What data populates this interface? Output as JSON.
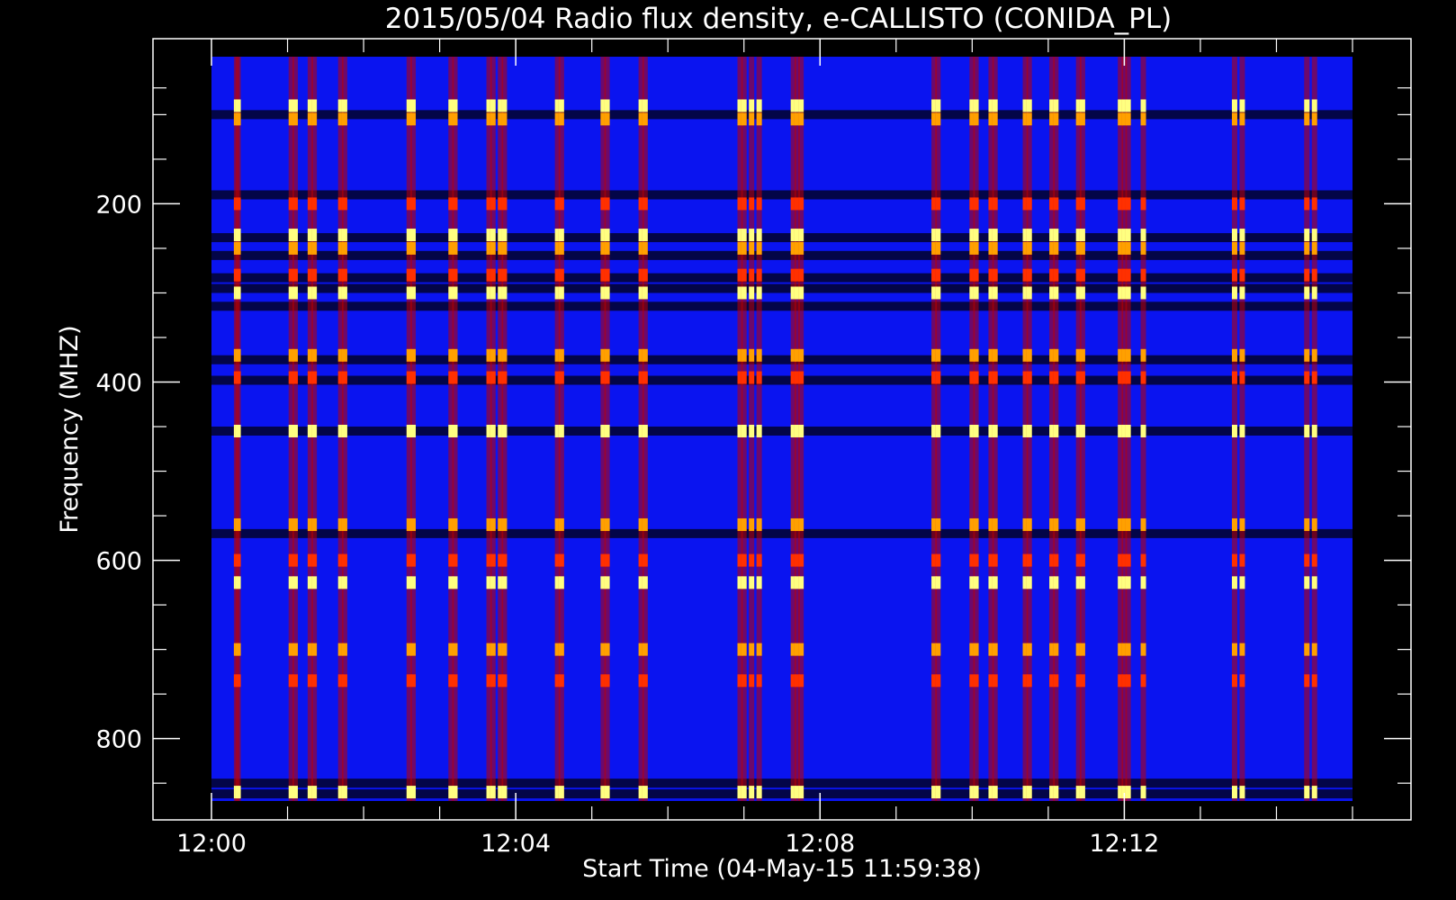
{
  "chart_data": {
    "type": "heatmap",
    "title": "2015/05/04  Radio flux density, e-CALLISTO (CONIDA_PL)",
    "xlabel": "Start Time (04-May-15 11:59:38)",
    "ylabel": "Frequency (MHZ)",
    "x_ticks": [
      "12:00",
      "12:04",
      "12:08",
      "12:12"
    ],
    "y_ticks": [
      200,
      400,
      600,
      800
    ],
    "y_range": [
      35,
      870
    ],
    "y_reversed": true,
    "x_range_minutes": [
      0,
      15
    ],
    "colormap": [
      "#000000",
      "#0000ff",
      "#c00000",
      "#ff3000",
      "#ffa000",
      "#ffff80"
    ],
    "background_color": "#0a14f0",
    "burst_minutes": [
      0.33,
      0.35,
      1.05,
      1.1,
      1.3,
      1.35,
      1.7,
      1.75,
      2.6,
      2.65,
      3.15,
      3.2,
      3.65,
      3.7,
      3.8,
      3.85,
      4.55,
      4.6,
      5.15,
      5.2,
      5.65,
      5.7,
      6.95,
      7.0,
      7.1,
      7.2,
      7.65,
      7.7,
      7.75,
      9.5,
      9.55,
      10.0,
      10.05,
      10.25,
      10.3,
      10.7,
      10.75,
      11.05,
      11.1,
      11.4,
      11.45,
      11.95,
      12.0,
      12.05,
      12.25,
      13.45,
      13.55,
      14.4,
      14.5
    ],
    "emission_bands_mhz": [
      90,
      105,
      200,
      235,
      250,
      280,
      300,
      370,
      395,
      455,
      560,
      600,
      625,
      700,
      735,
      860
    ],
    "dark_bands_mhz": [
      100,
      190,
      238,
      258,
      283,
      295,
      315,
      375,
      398,
      455,
      570,
      850,
      862
    ]
  }
}
